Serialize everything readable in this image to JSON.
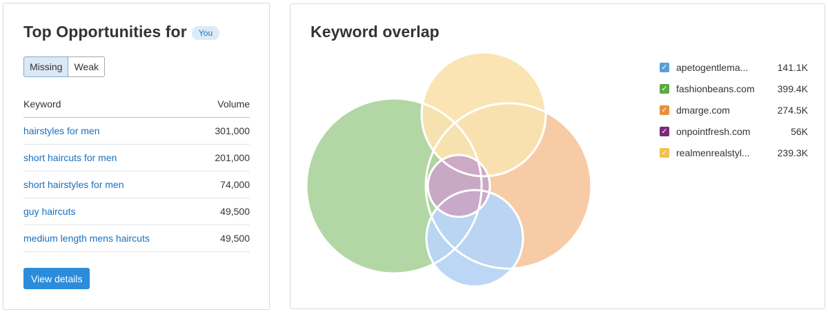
{
  "left_card": {
    "title": "Top Opportunities for",
    "badge": "You",
    "toggle": [
      "Missing",
      "Weak"
    ],
    "table": {
      "col_keyword": "Keyword",
      "col_volume": "Volume",
      "rows": [
        {
          "keyword": "hairstyles for men",
          "volume": "301,000"
        },
        {
          "keyword": "short haircuts for men",
          "volume": "201,000"
        },
        {
          "keyword": "short hairstyles for men",
          "volume": "74,000"
        },
        {
          "keyword": "guy haircuts",
          "volume": "49,500"
        },
        {
          "keyword": "medium length mens haircuts",
          "volume": "49,500"
        }
      ]
    },
    "view_details": "View details"
  },
  "right_card": {
    "title": "Keyword overlap",
    "legend": [
      {
        "name": "apetogentlema...",
        "value": "141.1K",
        "color": "#5a9fd8"
      },
      {
        "name": "fashionbeans.com",
        "value": "399.4K",
        "color": "#5aab3e"
      },
      {
        "name": "dmarge.com",
        "value": "274.5K",
        "color": "#eb8f3b"
      },
      {
        "name": "onpointfresh.com",
        "value": "56K",
        "color": "#7a2a78"
      },
      {
        "name": "realmenrealstyl...",
        "value": "239.3K",
        "color": "#f2c04f"
      }
    ]
  },
  "colors": {
    "link": "#1670c0",
    "primary_button": "#2b8cdc"
  }
}
